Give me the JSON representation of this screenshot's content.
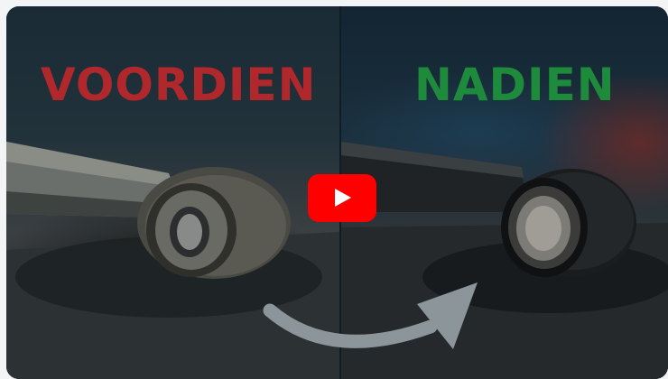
{
  "before": {
    "label": "VOORDIEN",
    "color": "#b0282c"
  },
  "after": {
    "label": "NADIEN",
    "color": "#1e8b3c"
  },
  "play_button": {
    "icon": "play-icon",
    "color": "#ff0000"
  },
  "arrow": {
    "icon": "curved-arrow-icon",
    "color": "#8c9599"
  }
}
